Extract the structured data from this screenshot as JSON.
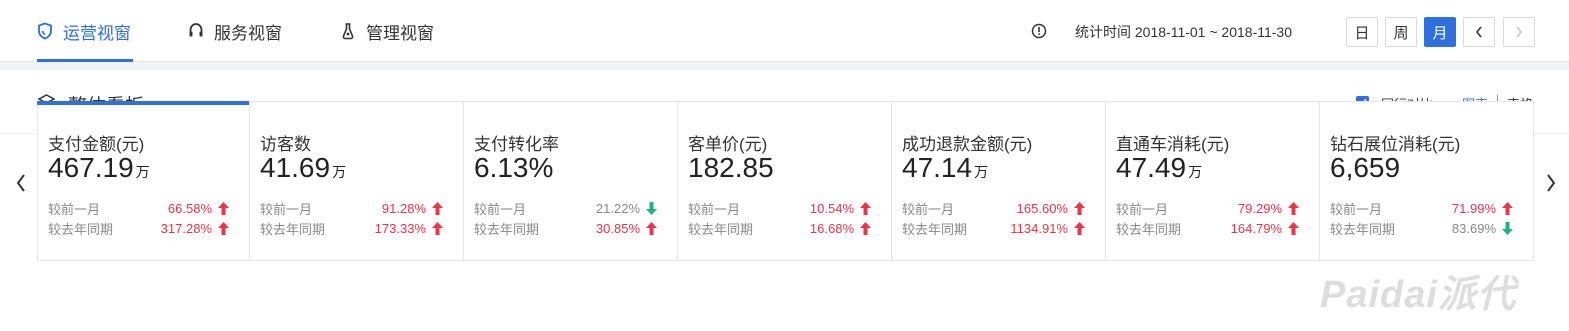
{
  "tabs": [
    {
      "label": "运营视窗",
      "icon": "shield-icon"
    },
    {
      "label": "服务视窗",
      "icon": "headset-icon"
    },
    {
      "label": "管理视窗",
      "icon": "flask-icon"
    }
  ],
  "header": {
    "stat_time": "统计时间 2018-11-01 ~ 2018-11-30",
    "period_buttons": {
      "day": "日",
      "week": "周",
      "month": "月"
    },
    "selected_period": "月"
  },
  "panel": {
    "title": "整体看板",
    "compare_label": "同行对比",
    "compare_checked": true,
    "view_chart": "图表",
    "view_table": "表格"
  },
  "colors": {
    "accent": "#2f6fde",
    "up": "#e8364b",
    "down": "#1bb380"
  },
  "cards": [
    {
      "label": "支付金额(元)",
      "value": "467.19",
      "unit": "万",
      "rows": [
        {
          "label": "较前一月",
          "pct": "66.58%",
          "dir": "up"
        },
        {
          "label": "较去年同期",
          "pct": "317.28%",
          "dir": "up"
        }
      ]
    },
    {
      "label": "访客数",
      "value": "41.69",
      "unit": "万",
      "rows": [
        {
          "label": "较前一月",
          "pct": "91.28%",
          "dir": "up"
        },
        {
          "label": "较去年同期",
          "pct": "173.33%",
          "dir": "up"
        }
      ]
    },
    {
      "label": "支付转化率",
      "value": "6.13%",
      "unit": "",
      "rows": [
        {
          "label": "较前一月",
          "pct": "21.22%",
          "dir": "down"
        },
        {
          "label": "较去年同期",
          "pct": "30.85%",
          "dir": "up"
        }
      ]
    },
    {
      "label": "客单价(元)",
      "value": "182.85",
      "unit": "",
      "rows": [
        {
          "label": "较前一月",
          "pct": "10.54%",
          "dir": "up"
        },
        {
          "label": "较去年同期",
          "pct": "16.68%",
          "dir": "up"
        }
      ]
    },
    {
      "label": "成功退款金额(元)",
      "value": "47.14",
      "unit": "万",
      "rows": [
        {
          "label": "较前一月",
          "pct": "165.60%",
          "dir": "up"
        },
        {
          "label": "较去年同期",
          "pct": "1134.91%",
          "dir": "up"
        }
      ]
    },
    {
      "label": "直通车消耗(元)",
      "value": "47.49",
      "unit": "万",
      "rows": [
        {
          "label": "较前一月",
          "pct": "79.29%",
          "dir": "up"
        },
        {
          "label": "较去年同期",
          "pct": "164.79%",
          "dir": "up"
        }
      ]
    },
    {
      "label": "钻石展位消耗(元)",
      "value": "6,659",
      "unit": "",
      "rows": [
        {
          "label": "较前一月",
          "pct": "71.99%",
          "dir": "up"
        },
        {
          "label": "较去年同期",
          "pct": "83.69%",
          "dir": "down"
        }
      ]
    }
  ],
  "watermark": "Paidai派代"
}
